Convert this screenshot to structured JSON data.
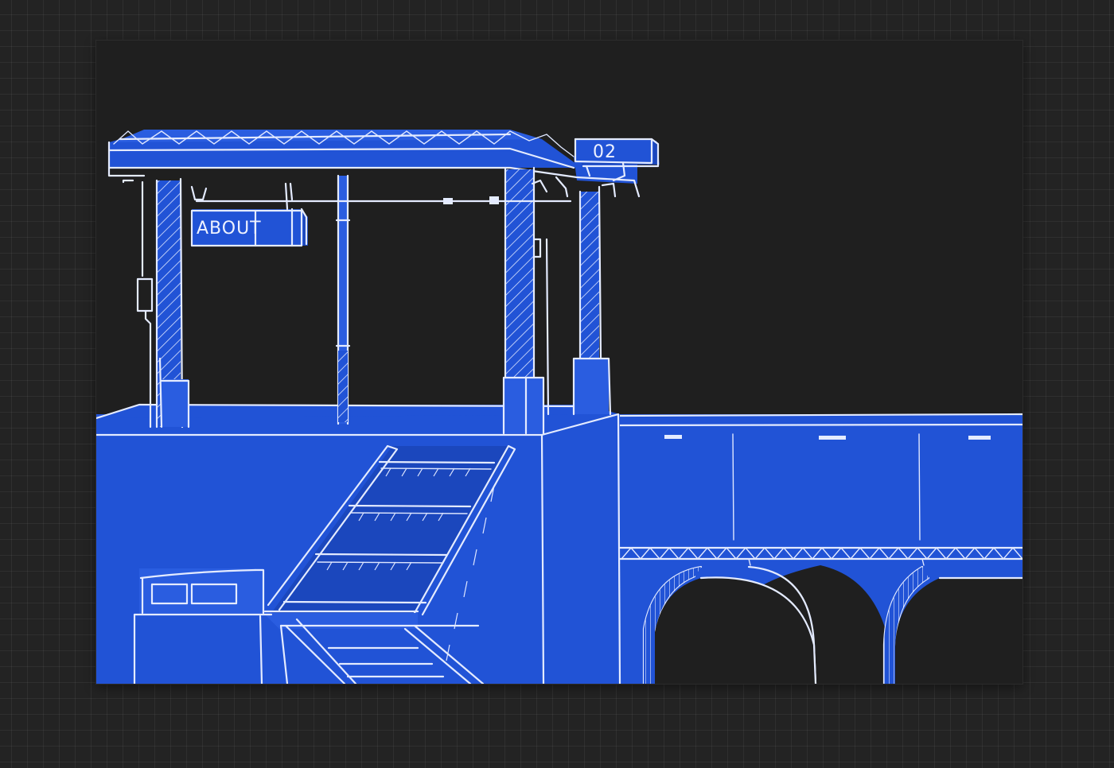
{
  "sign_about": {
    "label": "ABOUT"
  },
  "sign_number": {
    "label": "02"
  },
  "colors": {
    "page_background": "#232323",
    "blueprint_blue": "#2153d6",
    "chalk_line": "#e4ebff"
  }
}
